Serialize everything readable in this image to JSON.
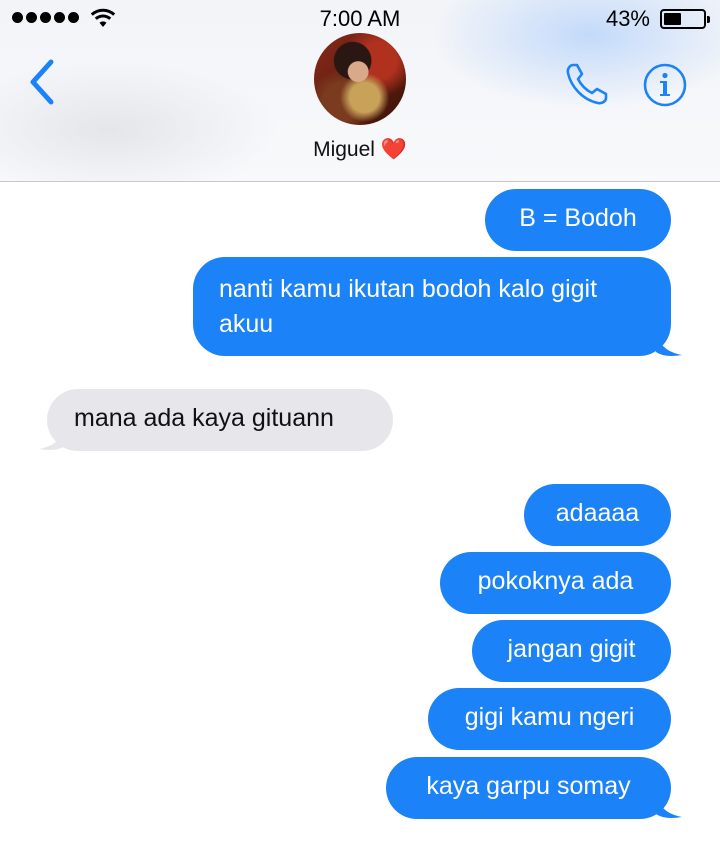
{
  "status_bar": {
    "time": "7:00 AM",
    "battery_percent": "43%",
    "battery_level": 0.43,
    "signal_bars": 5
  },
  "nav": {
    "back_icon": "chevron-left-icon",
    "contact_name": "Miguel ❤️",
    "phone_icon": "phone-icon",
    "info_icon": "info-icon"
  },
  "colors": {
    "accent": "#1c82f7",
    "outgoing_bubble": "#1c82f7",
    "incoming_bubble": "#e6e6eb"
  },
  "messages": [
    {
      "direction": "outgoing",
      "text": "B = Bodoh"
    },
    {
      "direction": "outgoing",
      "text": "nanti kamu ikutan bodoh kalo gigit akuu"
    },
    {
      "direction": "incoming",
      "text": "mana ada kaya gituann"
    },
    {
      "direction": "outgoing",
      "text": "adaaaa"
    },
    {
      "direction": "outgoing",
      "text": "pokoknya ada"
    },
    {
      "direction": "outgoing",
      "text": "jangan gigit"
    },
    {
      "direction": "outgoing",
      "text": "gigi kamu ngeri"
    },
    {
      "direction": "outgoing",
      "text": "kaya garpu somay"
    }
  ]
}
